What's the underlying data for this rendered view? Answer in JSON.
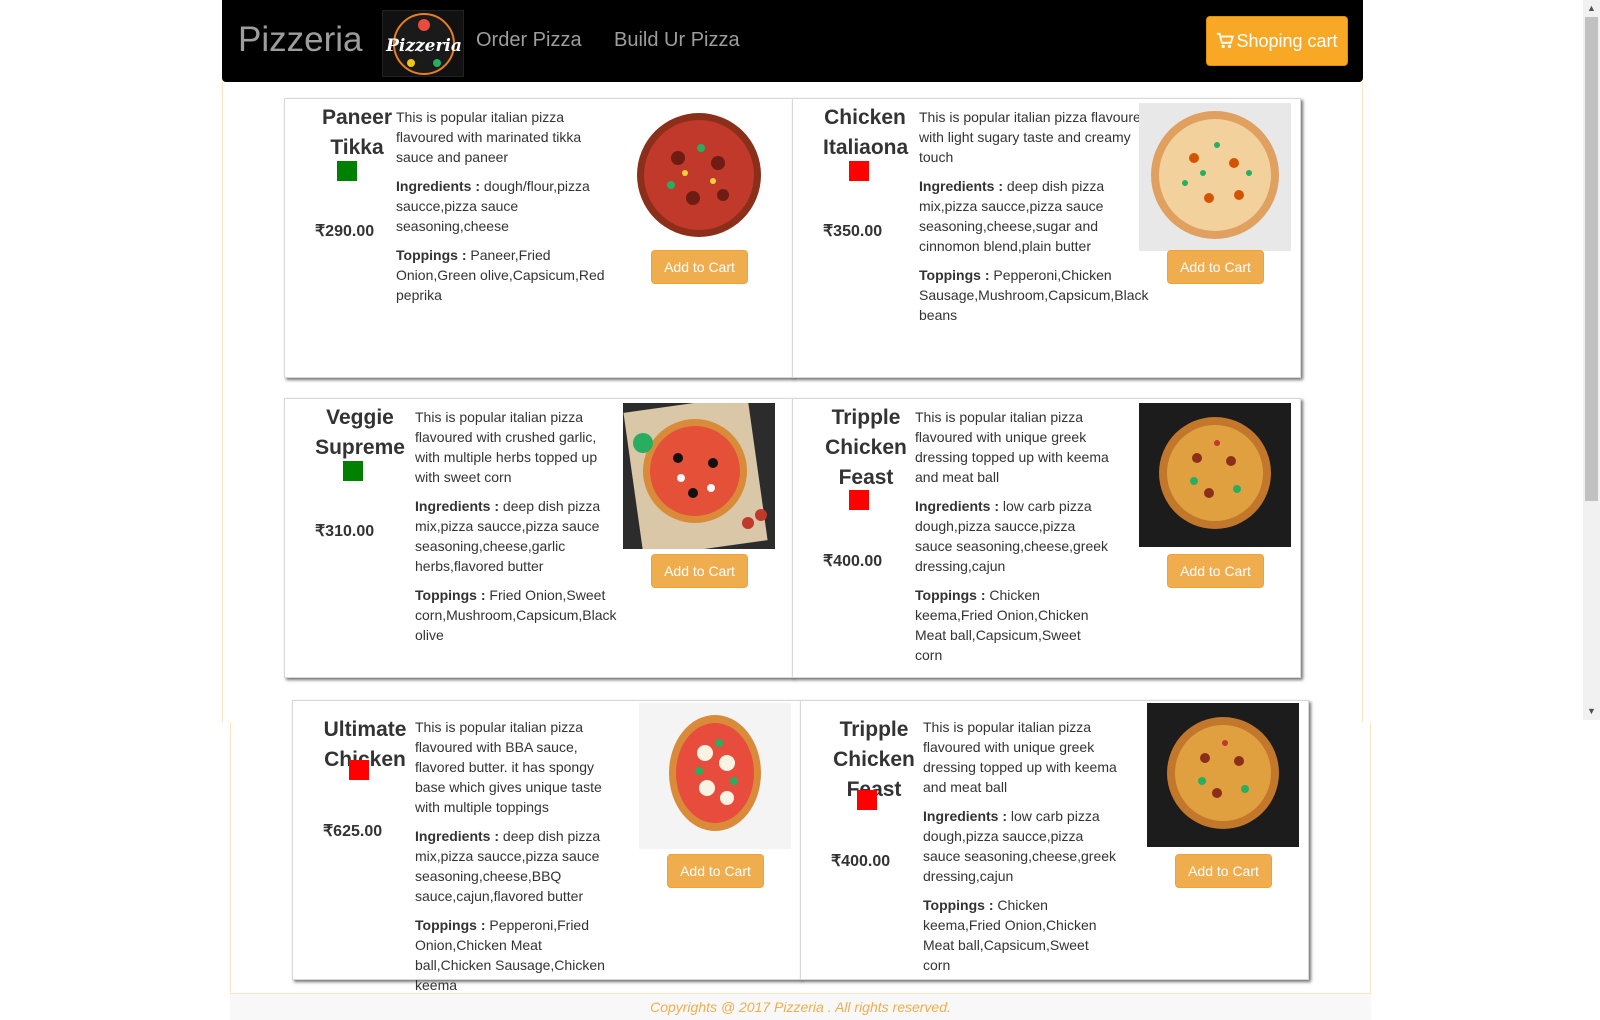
{
  "navbar": {
    "brand": "Pizzeria",
    "logo_text": "Pizzeria",
    "links": [
      "Order Pizza",
      "Build Ur Pizza"
    ],
    "cart_label": "Shoping cart"
  },
  "products": [
    {
      "name": "Paneer Tikka",
      "veg": true,
      "price": "₹290.00",
      "description": "This is popular italian pizza flavoured with marinated tikka sauce and paneer",
      "ingredients_label": "Ingredients :",
      "ingredients": "dough/flour,pizza saucce,pizza sauce seasoning,cheese",
      "toppings_label": "Toppings :",
      "toppings": "Paneer,Fried Onion,Green olive,Capsicum,Red peprika",
      "button": "Add to Cart"
    },
    {
      "name": "Chicken Italiaona",
      "veg": false,
      "price": "₹350.00",
      "description": "This is popular italian pizza flavoured with light sugary taste and creamy touch",
      "ingredients_label": "Ingredients :",
      "ingredients": "deep dish pizza mix,pizza saucce,pizza sauce seasoning,cheese,sugar and cinnomon blend,plain butter",
      "toppings_label": "Toppings :",
      "toppings": "Pepperoni,Chicken Sausage,Mushroom,Capsicum,Black beans",
      "button": "Add to Cart"
    },
    {
      "name": "Veggie Supreme",
      "veg": true,
      "price": "₹310.00",
      "description": "This is popular italian pizza flavoured with crushed garlic, with multiple herbs topped up with sweet corn",
      "ingredients_label": "Ingredients :",
      "ingredients": "deep dish pizza mix,pizza saucce,pizza sauce seasoning,cheese,garlic herbs,flavored butter",
      "toppings_label": "Toppings :",
      "toppings": "Fried Onion,Sweet corn,Mushroom,Capsicum,Black olive",
      "button": "Add to Cart"
    },
    {
      "name": "Tripple Chicken Feast",
      "veg": false,
      "price": "₹400.00",
      "description": "This is popular italian pizza flavoured with unique greek dressing topped up with keema and meat ball",
      "ingredients_label": "Ingredients :",
      "ingredients": "low carb pizza dough,pizza saucce,pizza sauce seasoning,cheese,greek dressing,cajun",
      "toppings_label": "Toppings :",
      "toppings": "Chicken keema,Fried Onion,Chicken Meat ball,Capsicum,Sweet corn",
      "button": "Add to Cart"
    },
    {
      "name": "Ultimate Chicken",
      "veg": false,
      "price": "₹625.00",
      "description": "This is popular italian pizza flavoured with BBA sauce, flavored butter. it has spongy base which gives unique taste with multiple toppings",
      "ingredients_label": "Ingredients :",
      "ingredients": "deep dish pizza mix,pizza saucce,pizza sauce seasoning,cheese,BBQ sauce,cajun,flavored butter",
      "toppings_label": "Toppings :",
      "toppings": "Pepperoni,Fried Onion,Chicken Meat ball,Chicken Sausage,Chicken keema",
      "button": "Add to Cart"
    },
    {
      "name": "Tripple Chicken Feast",
      "veg": false,
      "price": "₹400.00",
      "description": "This is popular italian pizza flavoured with unique greek dressing topped up with keema and meat ball",
      "ingredients_label": "Ingredients :",
      "ingredients": "low carb pizza dough,pizza saucce,pizza sauce seasoning,cheese,greek dressing,cajun",
      "toppings_label": "Toppings :",
      "toppings": "Chicken keema,Fried Onion,Chicken Meat ball,Capsicum,Sweet corn",
      "button": "Add to Cart"
    }
  ],
  "footer": {
    "text": "Copyrights @ 2017 Pizzeria . All rights reserved."
  },
  "colors": {
    "navbar": "#000000",
    "accent": "#f0ad4e",
    "veg": "#008000",
    "nonveg": "#ff0000"
  }
}
